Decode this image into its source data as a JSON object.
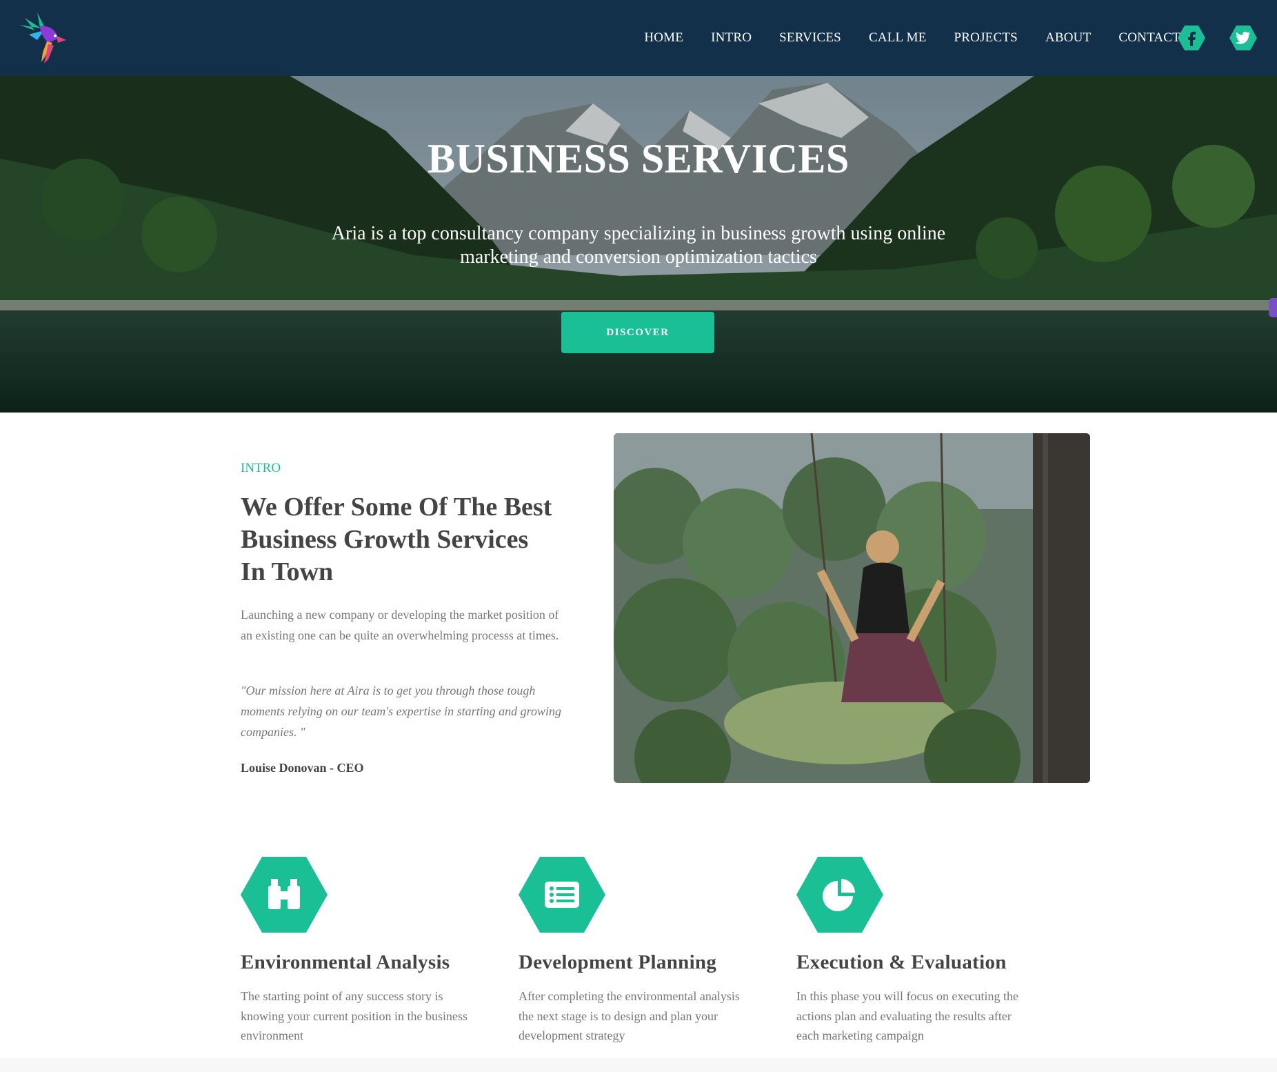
{
  "nav": {
    "items": [
      "HOME",
      "INTRO",
      "SERVICES",
      "CALL ME",
      "PROJECTS",
      "ABOUT",
      "CONTACT"
    ],
    "social": [
      "facebook-icon",
      "twitter-icon"
    ]
  },
  "hero": {
    "title": "BUSINESS SERVICES",
    "subtitle": "Aria is a top consultancy company specializing in business growth using online marketing and conversion optimization tactics",
    "button": "DISCOVER"
  },
  "intro": {
    "label": "INTRO",
    "heading": "We Offer Some Of The Best Business Growth Services In Town",
    "paragraph": "Launching a new company or developing the market position of an existing one can be quite an overwhelming processs at times.",
    "quote": "\"Our mission here at Aira is to get you through those tough moments relying on our team's expertise in starting and growing companies. \"",
    "author": "Louise Donovan - CEO"
  },
  "services": [
    {
      "icon": "binoculars-icon",
      "title": "Environmental Analysis",
      "text": "The starting point of any success story is knowing your current position in the business environment"
    },
    {
      "icon": "list-icon",
      "title": "Development Planning",
      "text": "After completing the environmental analysis the next stage is to design and plan your development strategy"
    },
    {
      "icon": "pie-chart-icon",
      "title": "Execution & Evaluation",
      "text": "In this phase you will focus on executing the actions plan and evaluating the results after each marketing campaign"
    }
  ],
  "colors": {
    "nav": "#13304a",
    "accent": "#1bbf96"
  }
}
